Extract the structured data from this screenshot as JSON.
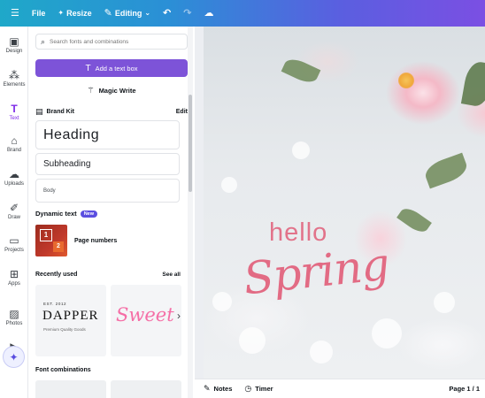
{
  "topbar": {
    "menu_icon": "hamburger-icon",
    "file_label": "File",
    "resize_label": "Resize",
    "editing_label": "Editing",
    "undo_icon": "undo-icon",
    "redo_icon": "redo-icon",
    "cloud_icon": "cloud-sync-icon"
  },
  "rail": {
    "items": [
      {
        "label": "Design",
        "icon": "design-icon"
      },
      {
        "label": "Elements",
        "icon": "elements-icon"
      },
      {
        "label": "Text",
        "icon": "text-icon"
      },
      {
        "label": "Brand",
        "icon": "brand-icon"
      },
      {
        "label": "Uploads",
        "icon": "uploads-icon"
      },
      {
        "label": "Draw",
        "icon": "draw-icon"
      },
      {
        "label": "Projects",
        "icon": "projects-icon"
      },
      {
        "label": "Apps",
        "icon": "apps-icon"
      },
      {
        "label": "Photos",
        "icon": "photos-icon"
      },
      {
        "label": "",
        "icon": "video-icon"
      }
    ],
    "active": "Text",
    "magic_icon": "magic-sparkle-icon"
  },
  "panel": {
    "search_placeholder": "Search fonts and combinations",
    "add_text_label": "Add a text box",
    "magic_write_label": "Magic Write",
    "brand_kit_label": "Brand Kit",
    "edit_label": "Edit",
    "heading_label": "Heading",
    "subheading_label": "Subheading",
    "body_label": "Body",
    "dynamic_text_label": "Dynamic text",
    "new_badge": "New",
    "page_numbers_label": "Page numbers",
    "page_numbers_thumb": {
      "first": "1",
      "second": "2"
    },
    "recently_used_label": "Recently used",
    "see_all_label": "See all",
    "recent": [
      {
        "est": "EST. 2012",
        "title": "DAPPER",
        "subtitle": "Premium Quality Goods"
      },
      {
        "title": "Sweet"
      }
    ],
    "font_combinations_label": "Font combinations"
  },
  "design": {
    "hello": "hello",
    "spring": "Spring"
  },
  "bottombar": {
    "notes_label": "Notes",
    "timer_label": "Timer",
    "page_label": "Page 1 / 1"
  },
  "colors": {
    "accent": "#7d2ae8",
    "add_text_button": "#7d53d8",
    "title_pink": "#e2738a"
  }
}
